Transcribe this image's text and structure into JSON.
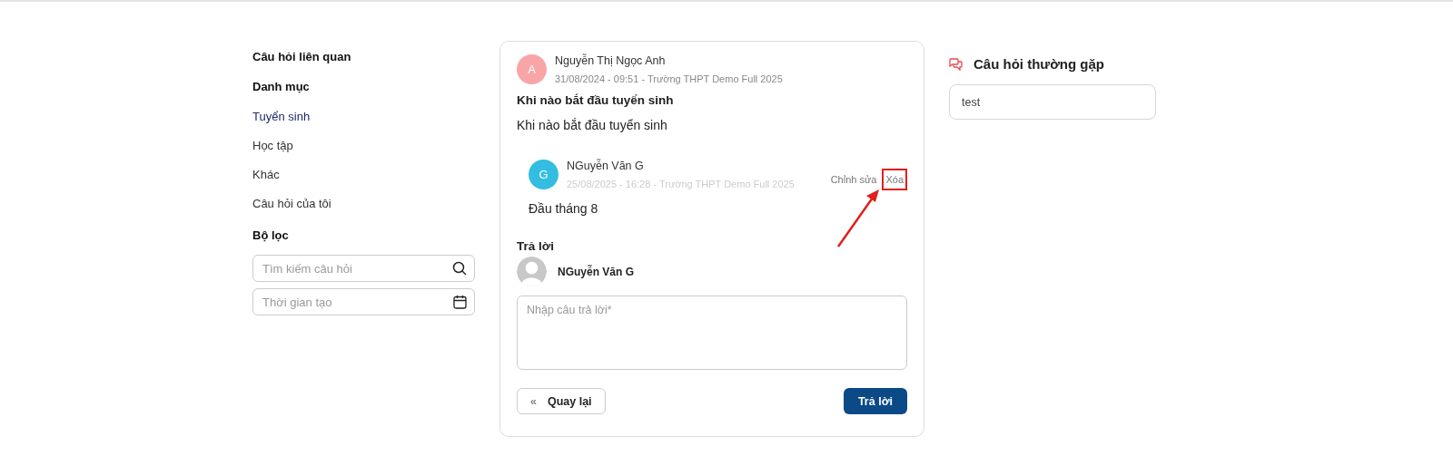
{
  "sidebar": {
    "related_title": "Câu hỏi liên quan",
    "categories_title": "Danh mục",
    "categories": [
      {
        "label": "Tuyển sinh",
        "selected": true
      },
      {
        "label": "Học tập",
        "selected": false
      },
      {
        "label": "Khác",
        "selected": false
      },
      {
        "label": "Câu hỏi của tôi",
        "selected": false
      }
    ],
    "filter_title": "Bộ lọc",
    "search": {
      "placeholder": "Tìm kiếm câu hỏi"
    },
    "date": {
      "placeholder": "Thời gian tạo"
    }
  },
  "question": {
    "avatar_letter": "A",
    "color": "#f8a5a8",
    "author": "Nguyễn Thị Ngọc Anh",
    "meta": "31/08/2024 - 09:51 - Trường THPT Demo Full 2025",
    "title": "Khi nào bắt đầu tuyển sinh",
    "body": "Khi nào bắt đầu tuyển sinh"
  },
  "answers": [
    {
      "avatar_letter": "G",
      "color": "#33bde0",
      "author": "NGuyễn Văn G",
      "meta": "25/08/2025 - 16:28 - Trường THPT Demo Full 2025",
      "body": "Đầu tháng 8",
      "actions": [
        {
          "label": "Chỉnh sửa",
          "highlighted": false
        },
        {
          "label": "Xóa",
          "highlighted": true
        }
      ]
    }
  ],
  "reply": {
    "title": "Trả lời",
    "user": "NGuyễn Văn G",
    "placeholder": "Nhập câu trả lời*",
    "back_icon": "«",
    "back_label": "Quay lại",
    "submit_label": "Trả lời"
  },
  "faq": {
    "title": "Câu hỏi thường gặp",
    "items": [
      "test"
    ]
  }
}
